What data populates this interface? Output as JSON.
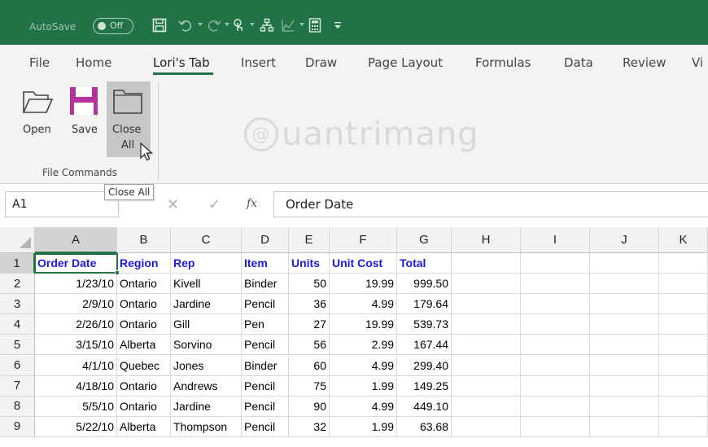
{
  "titlebar": {
    "autosave_label": "AutoSave",
    "autosave_state": "Off",
    "accent_color": "#217346"
  },
  "ribbon_tabs": [
    {
      "label": "File",
      "active": false
    },
    {
      "label": "Home",
      "active": false
    },
    {
      "label": "Lori's Tab",
      "active": true
    },
    {
      "label": "Insert",
      "active": false
    },
    {
      "label": "Draw",
      "active": false
    },
    {
      "label": "Page Layout",
      "active": false
    },
    {
      "label": "Formulas",
      "active": false
    },
    {
      "label": "Data",
      "active": false
    },
    {
      "label": "Review",
      "active": false
    },
    {
      "label": "Vi",
      "active": false
    }
  ],
  "ribbon": {
    "open_label": "Open",
    "save_label": "Save",
    "close_all_label_1": "Close",
    "close_all_label_2": "All",
    "group_label": "File Commands"
  },
  "watermark": {
    "symbol": "@",
    "text": "uantrimang"
  },
  "tooltip": "Close All",
  "formula_bar": {
    "name_box": "A1",
    "fx_label": "fx",
    "formula": "Order Date"
  },
  "grid": {
    "columns": [
      "A",
      "B",
      "C",
      "D",
      "E",
      "F",
      "G",
      "H",
      "I",
      "J",
      "K"
    ],
    "rows": [
      "1",
      "2",
      "3",
      "4",
      "5",
      "6",
      "7",
      "8",
      "9"
    ],
    "header_row": [
      "Order Date",
      "Region",
      "Rep",
      "Item",
      "Units",
      "Unit Cost",
      "Total"
    ],
    "data": [
      [
        "1/23/10",
        "Ontario",
        "Kivell",
        "Binder",
        "50",
        "19.99",
        "999.50"
      ],
      [
        "2/9/10",
        "Ontario",
        "Jardine",
        "Pencil",
        "36",
        "4.99",
        "179.64"
      ],
      [
        "2/26/10",
        "Ontario",
        "Gill",
        "Pen",
        "27",
        "19.99",
        "539.73"
      ],
      [
        "3/15/10",
        "Alberta",
        "Sorvino",
        "Pencil",
        "56",
        "2.99",
        "167.44"
      ],
      [
        "4/1/10",
        "Quebec",
        "Jones",
        "Binder",
        "60",
        "4.99",
        "299.40"
      ],
      [
        "4/18/10",
        "Ontario",
        "Andrews",
        "Pencil",
        "75",
        "1.99",
        "149.25"
      ],
      [
        "5/5/10",
        "Ontario",
        "Jardine",
        "Pencil",
        "90",
        "4.99",
        "449.10"
      ],
      [
        "5/22/10",
        "Alberta",
        "Thompson",
        "Pencil",
        "32",
        "1.99",
        "63.68"
      ]
    ],
    "header_color": "#1a1adb"
  }
}
